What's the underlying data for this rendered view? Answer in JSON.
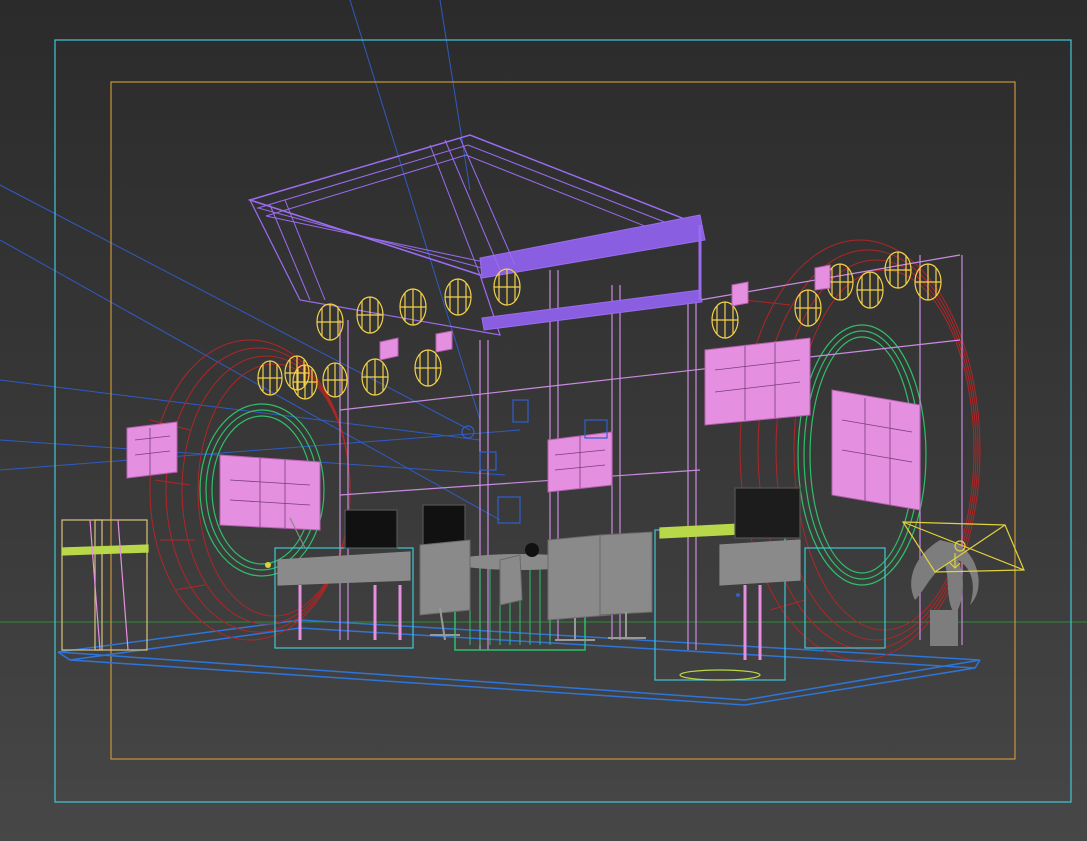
{
  "viewport": {
    "background": "#333333",
    "safe_frame_outer_color": "#3fc7d6",
    "safe_frame_inner_color": "#c9953a",
    "horizon_color": "#2e8b3a"
  },
  "colors": {
    "truss": "#9b6cf0",
    "truss_fill": "#8a5ee0",
    "lamp": "#f2d24a",
    "panel": "#e58fe0",
    "tire": "#b02626",
    "ring": "#2fbf6a",
    "chair": "#8a8a8a",
    "structure": "#c98be0",
    "floor": "#2f74d8",
    "camera": "#2f5fd0",
    "plant": "#7d7d7d",
    "selection": "#e0d23a",
    "stool": "#b8d84a"
  },
  "icons": {
    "camera_target": "camera-target-icon",
    "light_helper": "light-gizmo-icon"
  }
}
